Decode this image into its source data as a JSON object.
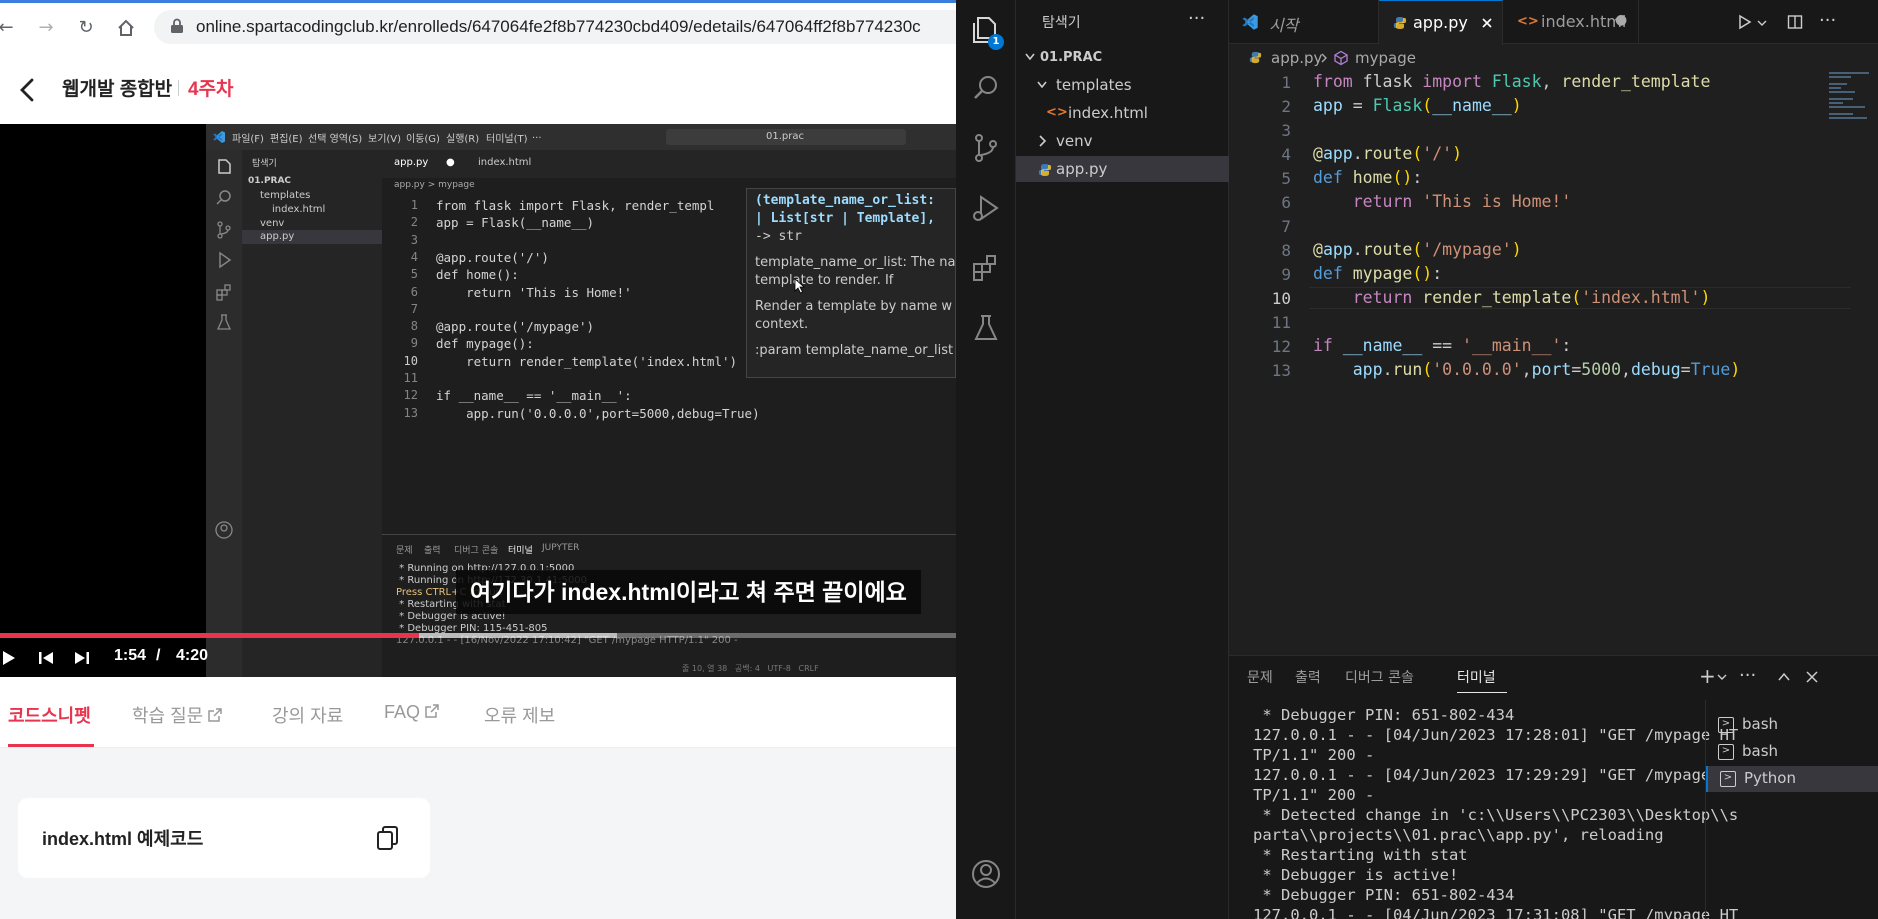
{
  "colors": {
    "accent_red": "#e8344e",
    "vscode_blue": "#0078d4",
    "editor_bg": "#1f1f1f"
  },
  "browser": {
    "url": "online.spartacodingclub.kr/enrolleds/647064fe2f8b774230cbd409/edetails/647064ff2f8b774230c",
    "icons": [
      "back-arrow-icon",
      "forward-arrow-icon",
      "reload-icon",
      "home-icon",
      "lock-icon"
    ]
  },
  "course": {
    "title": "웹개발 종합반",
    "week": "4주차"
  },
  "video": {
    "subtitle": "여기다가 index.html이라고 쳐 주면 끝이에요",
    "current_time": "1:54",
    "time_separator": "/",
    "duration": "4:20",
    "progress_fraction": 0.438,
    "buffered_fraction": 0.645,
    "inner": {
      "menu": [
        "파일(F)",
        "편집(E)",
        "선택 영역(S)",
        "보기(V)",
        "이동(G)",
        "실행(R)",
        "터미널(T)",
        "..."
      ],
      "search": "01.prac",
      "sidebar_title": "탐색기",
      "sidebar_items": [
        "01.PRAC",
        "templates",
        "index.html",
        "venv",
        "app.py"
      ],
      "tabs": [
        "app.py",
        "index.html"
      ],
      "breadcrumb": "app.py > mypage",
      "code": [
        "from flask import Flask, render_templ",
        "app = Flask(__name__)",
        "",
        "@app.route('/')",
        "def home():",
        "    return 'This is Home!'",
        "",
        "@app.route('/mypage')",
        "def mypage():",
        "    return render_template('index.html')",
        "",
        "if __name__ == '__main__':",
        "    app.run('0.0.0.0',port=5000,debug=True)"
      ],
      "hover": {
        "sig1": "(template_name_or_list:",
        "sig2": "| List[str | Template],",
        "sig3": "-> str",
        "doc1": "template_name_or_list: The na",
        "doc2": "template to render. If",
        "doc3": "Render a template by name w",
        "doc4": "context.",
        "doc5": ":param template_name_or_list"
      },
      "panel_tabs": [
        "문제",
        "출력",
        "디버그 콘솔",
        "터미널",
        "JUPYTER"
      ],
      "terminal": [
        " * Running on http://127.0.0.1:5000",
        " * Running on http://172.30.1.41:5000",
        "Press CTRL+C to quit",
        " * Restarting with stat",
        " * Debugger is active!",
        " * Debugger PIN: 115-451-805",
        "127.0.0.1 - - [16/Nov/2022 17:10:42] \"GET /mypage HTTP/1.1\" 200 -"
      ],
      "statusbar": "줄 10, 열 38   공백: 4   UTF-8   CRLF"
    }
  },
  "lesson_tabs": [
    "코드스니펫",
    "학습 질문",
    "강의 자료",
    "FAQ",
    "오류 제보"
  ],
  "snippet": {
    "title": "index.html 예제코드"
  },
  "vscode": {
    "explorer_badge": "1",
    "sidebar": {
      "title": "탐색기",
      "more": "···",
      "folder": "01.PRAC",
      "items": [
        "templates",
        "index.html",
        "venv",
        "app.py"
      ]
    },
    "tabs": [
      {
        "label": "시작"
      },
      {
        "label": "app.py"
      },
      {
        "label": "index.html"
      }
    ],
    "breadcrumb": {
      "file": "app.py",
      "symbol": "mypage"
    },
    "line_numbers": [
      "1",
      "2",
      "3",
      "4",
      "5",
      "6",
      "7",
      "8",
      "9",
      "10",
      "11",
      "12",
      "13"
    ],
    "current_line": "10",
    "panel": {
      "tabs": [
        "문제",
        "출력",
        "디버그 콘솔",
        "터미널"
      ],
      "terminal_lines": [
        " * Debugger PIN: 651-802-434",
        "127.0.0.1 - - [04/Jun/2023 17:28:01] \"GET /mypage HT",
        "TP/1.1\" 200 -",
        "127.0.0.1 - - [04/Jun/2023 17:29:29] \"GET /mypage HT",
        "TP/1.1\" 200 -",
        " * Detected change in 'c:\\\\Users\\\\PC2303\\\\Desktop\\\\s",
        "parta\\\\projects\\\\01.prac\\\\app.py', reloading",
        " * Restarting with stat",
        " * Debugger is active!",
        " * Debugger PIN: 651-802-434",
        "127.0.0.1 - - [04/Jun/2023 17:31:08] \"GET /mypage HT"
      ],
      "terminals": [
        "bash",
        "bash",
        "Python"
      ]
    }
  }
}
